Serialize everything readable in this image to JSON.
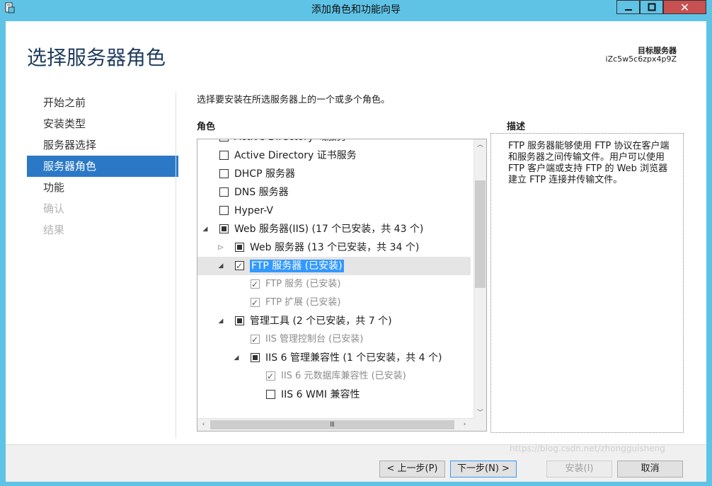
{
  "window": {
    "title": "添加角色和功能向导"
  },
  "header": {
    "page_title": "选择服务器角色",
    "target_label": "目标服务器",
    "target_value": "iZc5w5c6zpx4p9Z"
  },
  "nav": {
    "items": [
      {
        "label": "开始之前",
        "state": "normal"
      },
      {
        "label": "安装类型",
        "state": "normal"
      },
      {
        "label": "服务器选择",
        "state": "normal"
      },
      {
        "label": "服务器角色",
        "state": "active"
      },
      {
        "label": "功能",
        "state": "normal"
      },
      {
        "label": "确认",
        "state": "disabled"
      },
      {
        "label": "结果",
        "state": "disabled"
      }
    ]
  },
  "main": {
    "instruction": "选择要安装在所选服务器上的一个或多个角色。",
    "roles_header": "角色",
    "description_header": "描述",
    "description": "FTP 服务器能够使用 FTP 协议在客户端和服务器之间传输文件。用户可以使用 FTP 客户端或支持 FTP 的 Web 浏览器建立 FTP 连接并传输文件。",
    "roles": [
      {
        "label": "Active Directory 域服务",
        "level": 0,
        "check": "empty",
        "expander": ""
      },
      {
        "label": "Active Directory 证书服务",
        "level": 0,
        "check": "empty",
        "expander": ""
      },
      {
        "label": "DHCP 服务器",
        "level": 0,
        "check": "empty",
        "expander": ""
      },
      {
        "label": "DNS 服务器",
        "level": 0,
        "check": "empty",
        "expander": ""
      },
      {
        "label": "Hyper-V",
        "level": 0,
        "check": "empty",
        "expander": ""
      },
      {
        "label": "Web 服务器(IIS) (17 个已安装，共 43 个)",
        "level": 0,
        "check": "partial",
        "expander": "expanded"
      },
      {
        "label": "Web 服务器 (13 个已安装，共 34 个)",
        "level": 1,
        "check": "partial",
        "expander": "collapsed"
      },
      {
        "label": "FTP 服务器 (已安装)",
        "level": 1,
        "check": "checked",
        "expander": "expanded",
        "selected": true
      },
      {
        "label": "FTP 服务 (已安装)",
        "level": 2,
        "check": "checked-gray",
        "expander": "",
        "gray": true
      },
      {
        "label": "FTP 扩展 (已安装)",
        "level": 2,
        "check": "checked-gray",
        "expander": "",
        "gray": true
      },
      {
        "label": "管理工具 (2 个已安装，共 7 个)",
        "level": 1,
        "check": "partial",
        "expander": "expanded"
      },
      {
        "label": "IIS 管理控制台 (已安装)",
        "level": 2,
        "check": "checked-gray",
        "expander": "",
        "gray": true
      },
      {
        "label": "IIS 6 管理兼容性 (1 个已安装，共 4 个)",
        "level": 2,
        "check": "partial",
        "expander": "expanded"
      },
      {
        "label": "IIS 6 元数据库兼容性 (已安装)",
        "level": 3,
        "check": "checked-gray",
        "expander": "",
        "gray": true
      },
      {
        "label": "IIS 6 WMI 兼容性",
        "level": 3,
        "check": "empty",
        "expander": ""
      }
    ]
  },
  "footer": {
    "prev": "< 上一步(P)",
    "next": "下一步(N) >",
    "install": "安装(I)",
    "cancel": "取消"
  },
  "watermark": "https://blog.csdn.net/zhongguisheng"
}
